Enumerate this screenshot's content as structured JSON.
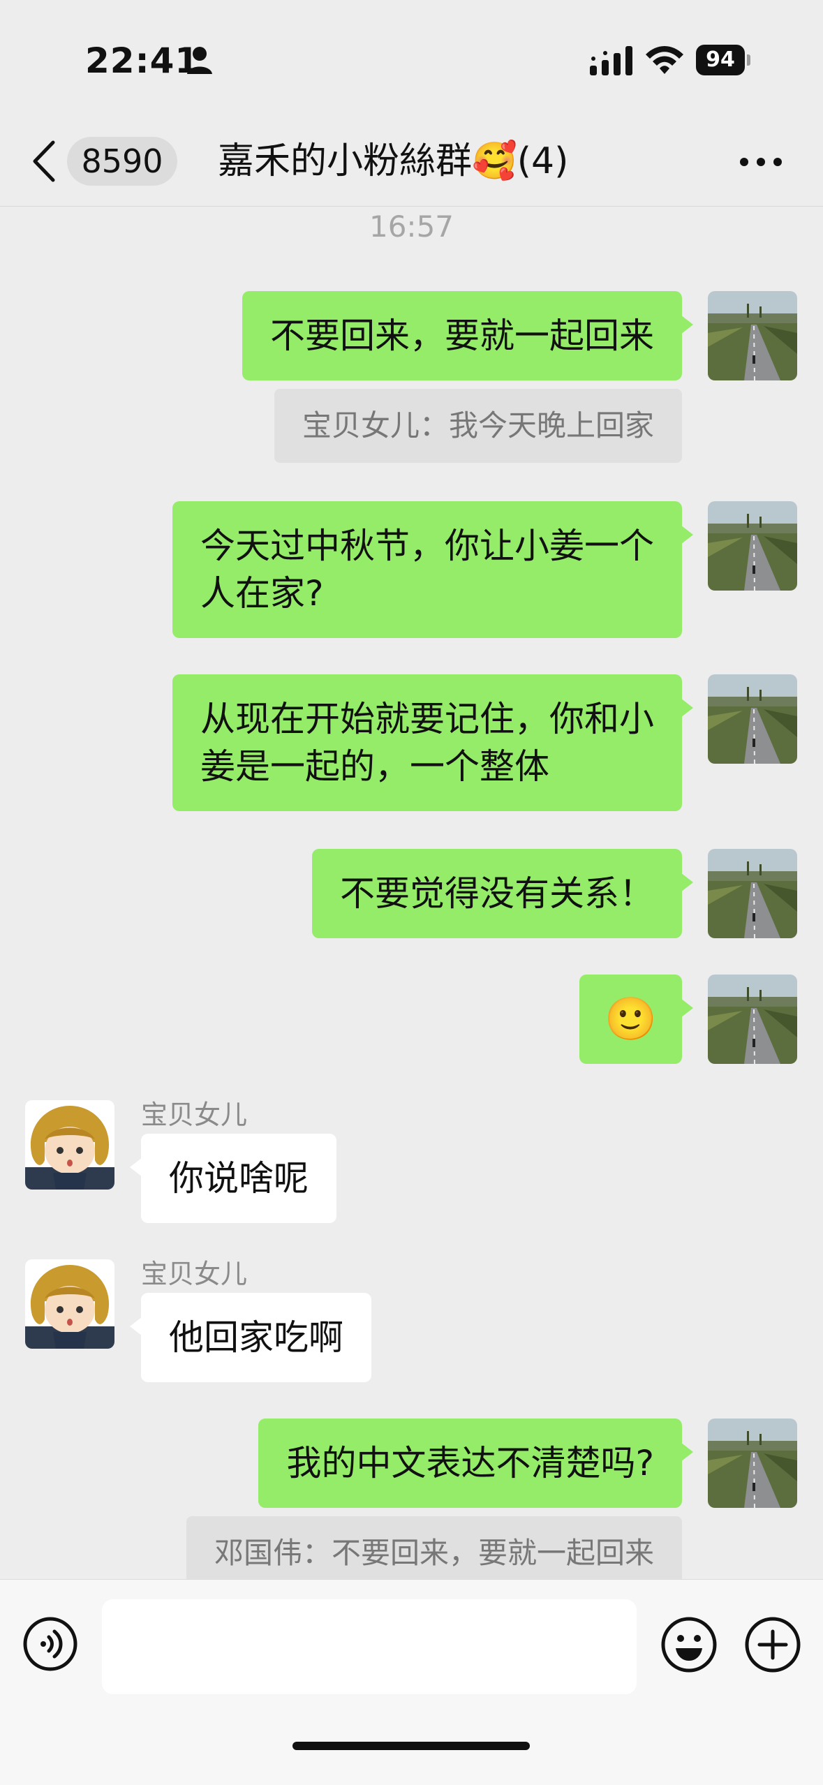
{
  "status_bar": {
    "time": "22:41",
    "battery": "94"
  },
  "nav": {
    "unread_count": "8590",
    "title": "嘉禾的小粉絲群🥰(4)"
  },
  "chat": {
    "timestamp": "16:57",
    "messages": [
      {
        "text": "不要回来，要就一起回来",
        "quote": "宝贝女儿：我今天晚上回家"
      },
      {
        "line1": "今天过中秋节，你让小姜一个",
        "line2": "人在家?"
      },
      {
        "line1": "从现在开始就要记住，你和小",
        "line2": "姜是一起的，一个整体"
      },
      {
        "text": "不要觉得没有关系！"
      },
      {
        "text": "🙂"
      },
      {
        "sender": "宝贝女儿",
        "text": "你说啥呢"
      },
      {
        "sender": "宝贝女儿",
        "text": "他回家吃啊"
      },
      {
        "text": "我的中文表达不清楚吗?",
        "quote": "邓国伟：不要回来，要就一起回来"
      }
    ]
  },
  "input": {
    "value": "",
    "placeholder": ""
  },
  "icons": {
    "back": "chevron-left-icon",
    "more": "more-dots-icon",
    "voice": "voice-icon",
    "emoji": "emoji-icon",
    "plus": "plus-icon"
  },
  "colors": {
    "background": "#ededed",
    "outgoing_bubble": "#95ec69",
    "incoming_bubble": "#ffffff",
    "quote_bg": "#e0e0e0"
  }
}
